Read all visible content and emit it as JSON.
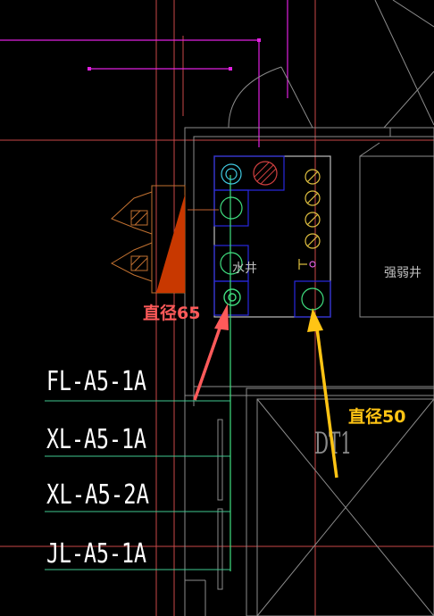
{
  "pipe_labels": [
    "FL-A5-1A",
    "XL-A5-1A",
    "XL-A5-2A",
    "JL-A5-1A"
  ],
  "shaft_label": "水井",
  "room_label": "强弱井",
  "elevator_label": "DT1",
  "annotations": {
    "left": "直径65",
    "right": "直径50"
  },
  "colors": {
    "background": "#000000",
    "wall": "#9a9a9a",
    "grid_red": "#d05050",
    "magenta": "#e020e0",
    "blue": "#2020e0",
    "green": "#40e080",
    "annotation_red": "#ff5a5a",
    "annotation_yellow": "#ffc414",
    "hydrant_orange": "#c04000"
  }
}
